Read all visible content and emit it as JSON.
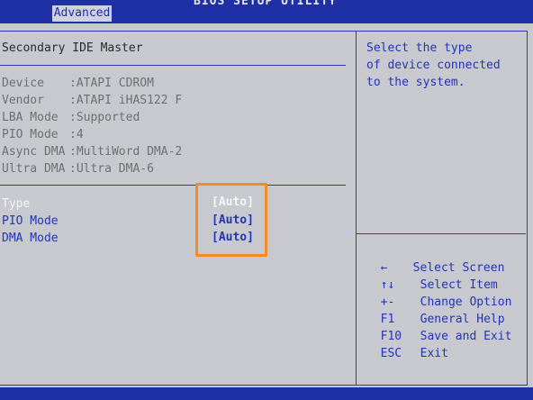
{
  "header": {
    "title": "BIOS SETUP UTILITY",
    "tab_advanced": "Advanced"
  },
  "left": {
    "section_title": "Secondary IDE Master",
    "info": [
      {
        "label": "Device",
        "value": ":ATAPI CDROM"
      },
      {
        "label": "Vendor",
        "value": ":ATAPI iHAS122 F"
      },
      {
        "label": "LBA Mode",
        "value": ":Supported"
      },
      {
        "label": "PIO Mode",
        "value": ":4"
      },
      {
        "label": "Async DMA",
        "value": ":MultiWord DMA-2"
      },
      {
        "label": "Ultra DMA",
        "value": ":Ultra DMA-6"
      }
    ],
    "settings": [
      {
        "label": "Type",
        "value": "[Auto]"
      },
      {
        "label": "PIO Mode",
        "value": "[Auto]"
      },
      {
        "label": "DMA Mode",
        "value": "[Auto]"
      }
    ]
  },
  "help": {
    "lines": [
      "Select the type",
      "of device connected",
      "to the system."
    ]
  },
  "keys": [
    {
      "key": "←",
      "action": "Select Screen"
    },
    {
      "key": "↑↓",
      "action": "Select Item"
    },
    {
      "key": "+-",
      "action": "Change Option"
    },
    {
      "key": "F1",
      "action": "General Help"
    },
    {
      "key": "F10",
      "action": "Save and Exit"
    },
    {
      "key": "ESC",
      "action": "Exit"
    }
  ],
  "colors": {
    "accent_blue": "#2435b5",
    "highlight_orange": "#f28c27",
    "panel_bg": "#c7c9cf"
  }
}
